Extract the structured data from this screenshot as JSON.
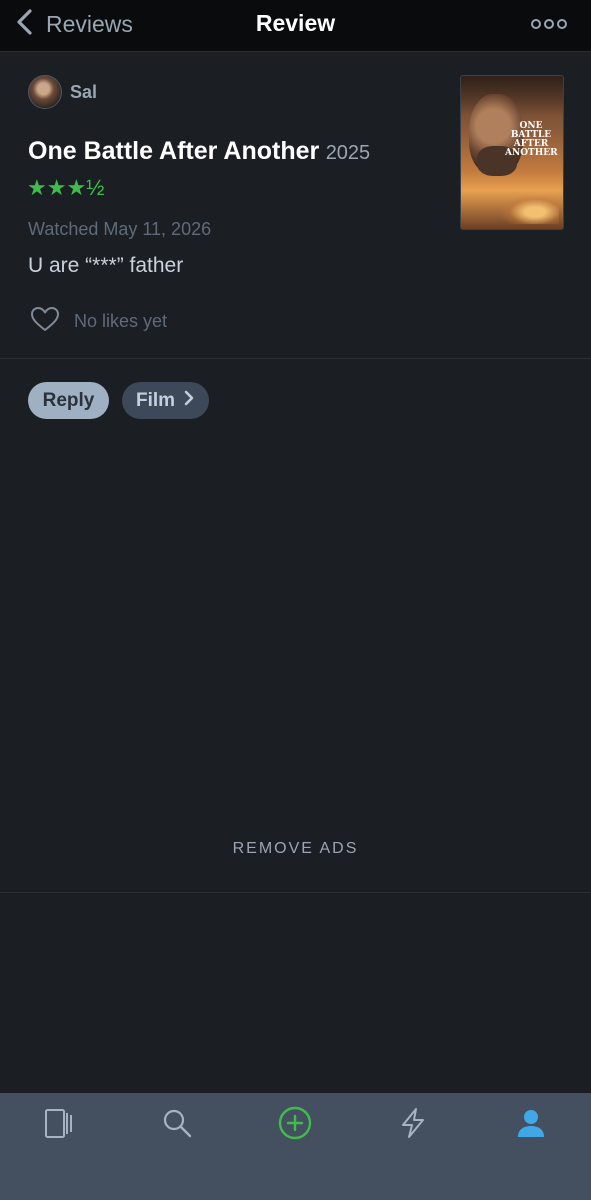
{
  "header": {
    "back_label": "Reviews",
    "title": "Review"
  },
  "review": {
    "author": "Sal",
    "film_title": "One Battle After Another",
    "film_year": "2025",
    "rating_stars": "★★★½",
    "rating_value": 3.5,
    "watched": "Watched May 11, 2026",
    "text": "U are “***” father",
    "likes": "No likes yet",
    "poster_text": "ONE\nBATTLE\nAFTER\nANOTHER"
  },
  "actions": {
    "reply": "Reply",
    "film": "Film"
  },
  "ads": {
    "remove": "REMOVE ADS"
  },
  "tabbar": {
    "items": [
      {
        "icon": "films-icon",
        "active": false
      },
      {
        "icon": "search-icon",
        "active": false
      },
      {
        "icon": "add-icon",
        "active": false
      },
      {
        "icon": "activity-icon",
        "active": false
      },
      {
        "icon": "profile-icon",
        "active": true
      }
    ]
  },
  "colors": {
    "background": "#1b1e23",
    "star_green": "#40bc4d",
    "active_tab": "#40a8e6",
    "tabbar": "#44505f"
  }
}
